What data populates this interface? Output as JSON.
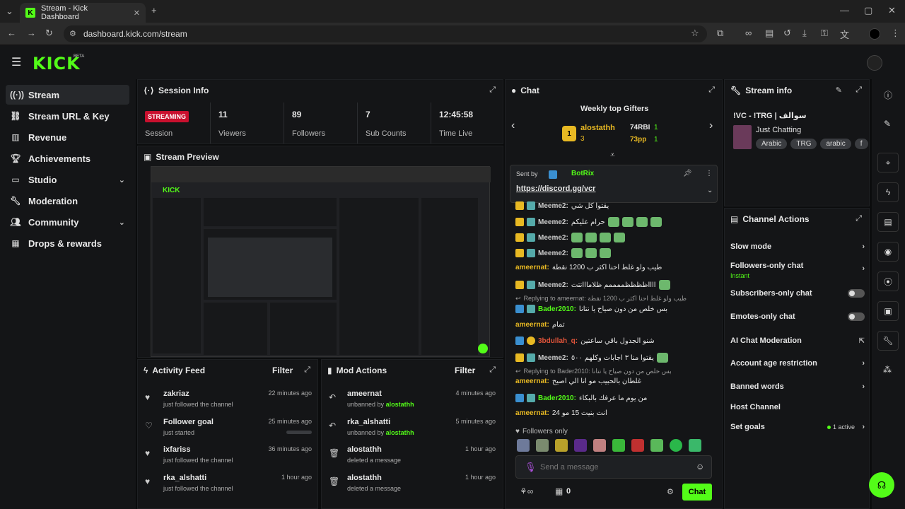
{
  "browser": {
    "tab_title": "Stream - Kick Dashboard",
    "url": "dashboard.kick.com/stream"
  },
  "header": {
    "logo": "KICK",
    "beta": "BETA"
  },
  "sidebar": {
    "items": [
      {
        "label": "Stream",
        "icon": "broadcast-icon",
        "active": true
      },
      {
        "label": "Stream URL & Key",
        "icon": "link-icon"
      },
      {
        "label": "Revenue",
        "icon": "bar-chart-icon"
      },
      {
        "label": "Achievements",
        "icon": "trophy-icon"
      },
      {
        "label": "Studio",
        "icon": "monitor-icon",
        "expandable": true
      },
      {
        "label": "Moderation",
        "icon": "wrench-icon"
      },
      {
        "label": "Community",
        "icon": "users-icon",
        "expandable": true
      },
      {
        "label": "Drops & rewards",
        "icon": "gift-icon"
      }
    ]
  },
  "session": {
    "title": "Session Info",
    "badge": "STREAMING",
    "badge_label": "Session",
    "stats": [
      {
        "value": "11",
        "label": "Viewers"
      },
      {
        "value": "89",
        "label": "Followers"
      },
      {
        "value": "7",
        "label": "Sub Counts"
      },
      {
        "value": "12:45:58",
        "label": "Time Live"
      }
    ]
  },
  "preview": {
    "title": "Stream Preview"
  },
  "activity": {
    "title": "Activity Feed",
    "filter": "Filter",
    "items": [
      {
        "name": "zakriaz",
        "sub": "just followed the channel",
        "time": "22 minutes ago",
        "icon": "heart-icon"
      },
      {
        "name": "Follower goal",
        "sub": "just started",
        "time": "25 minutes ago",
        "icon": "heart-outline-icon",
        "progress": 0.0
      },
      {
        "name": "ixfariss",
        "sub": "just followed the channel",
        "time": "36 minutes ago",
        "icon": "heart-icon"
      },
      {
        "name": "rka_alshatti",
        "sub": "just followed the channel",
        "time": "1 hour ago",
        "icon": "heart-icon"
      }
    ]
  },
  "mod": {
    "title": "Mod Actions",
    "filter": "Filter",
    "items": [
      {
        "name": "ameernat",
        "sub": "unbanned by",
        "by": "alostathh",
        "time": "4 minutes ago",
        "icon": "undo-icon"
      },
      {
        "name": "rka_alshatti",
        "sub": "unbanned by",
        "by": "alostathh",
        "time": "5 minutes ago",
        "icon": "undo-icon"
      },
      {
        "name": "alostathh",
        "sub": "deleted a message",
        "by": "",
        "time": "1 hour ago",
        "icon": "trash-icon"
      },
      {
        "name": "alostathh",
        "sub": "deleted a message",
        "by": "",
        "time": "1 hour ago",
        "icon": "trash-icon"
      }
    ]
  },
  "chat": {
    "title": "Chat",
    "gifters_title": "Weekly top Gifters",
    "gifters": [
      {
        "name": "alostathh",
        "count": "3",
        "rank": "1"
      },
      {
        "name": "74RBI",
        "count": "1"
      },
      {
        "name": "73pp",
        "count": "1"
      }
    ],
    "pinned": {
      "sent_by": "Sent by",
      "bot": "BotRix",
      "link": "https://discord.gg/vcr"
    },
    "messages": [
      {
        "user": "Meeme2:",
        "text": "يقتوا كل شي",
        "color": "#ccc"
      },
      {
        "user": "Meeme2:",
        "text": "حرام عليكم",
        "color": "#ccc"
      },
      {
        "user": "Meeme2:",
        "text": "",
        "color": "#ccc"
      },
      {
        "user": "Meeme2:",
        "text": "",
        "color": "#ccc"
      },
      {
        "user": "ameernat:",
        "text": "طيب ولو غلط احنا اكثر ب 1200 نقطة",
        "color": "#e8b923"
      },
      {
        "user": "Meeme2:",
        "text": "ااااظظظظممممم ظلاماااتتت",
        "color": "#ccc"
      },
      {
        "reply": "Replying to ameernat: طيب ولو غلط احنا اكثر ب 1200 نقطة"
      },
      {
        "user": "Bader2010:",
        "text": "بس خلص من دون صياح يا نتانا",
        "color": "#53fc18"
      },
      {
        "user": "ameernat:",
        "text": "تمام",
        "color": "#e8b923"
      },
      {
        "user": "3bdullah_q:",
        "text": "شنو الجدول باقي ساعتين",
        "color": "#e0543a"
      },
      {
        "user": "Meeme2:",
        "text": "يقتوا منا ٣ اجابات وكلهم ٥٠٠",
        "color": "#ccc"
      },
      {
        "reply": "Replying to Bader2010: بس خلص من دون صياح يا نتانا"
      },
      {
        "user": "ameernat:",
        "text": "غلطان بالحبيب مو انا الي اصيح",
        "color": "#e8b923"
      },
      {
        "user": "Bader2010:",
        "text": "من يوم ما عرفك بالبكاء",
        "color": "#53fc18"
      },
      {
        "user": "ameernat:",
        "text": "انت بنيت 15 مو 24",
        "color": "#e8b923"
      }
    ],
    "followers_only": "Followers only",
    "placeholder": "Send a message",
    "send": "Chat",
    "count": "0"
  },
  "stream_info": {
    "title": "Stream info",
    "stream_title": "!VC - !TRG | سوالف",
    "category": "Just Chatting",
    "tags": [
      "Arabic",
      "TRG",
      "arabic",
      "f"
    ]
  },
  "channel_actions": {
    "title": "Channel Actions",
    "items": [
      {
        "label": "Slow mode",
        "type": "chevron"
      },
      {
        "label": "Followers-only chat",
        "sub": "Instant",
        "type": "chevron"
      },
      {
        "label": "Subscribers-only chat",
        "type": "toggle",
        "on": false
      },
      {
        "label": "Emotes-only chat",
        "type": "toggle",
        "on": false
      },
      {
        "label": "AI Chat Moderation",
        "type": "external"
      },
      {
        "label": "Account age restriction",
        "type": "chevron"
      },
      {
        "label": "Banned words",
        "type": "chevron"
      },
      {
        "label": "Host Channel",
        "type": "none"
      },
      {
        "label": "Set goals",
        "type": "chevron",
        "status": "1 active"
      }
    ]
  },
  "colors": {
    "accent": "#53fc18",
    "live": "#c8102e",
    "panel": "#141517"
  }
}
